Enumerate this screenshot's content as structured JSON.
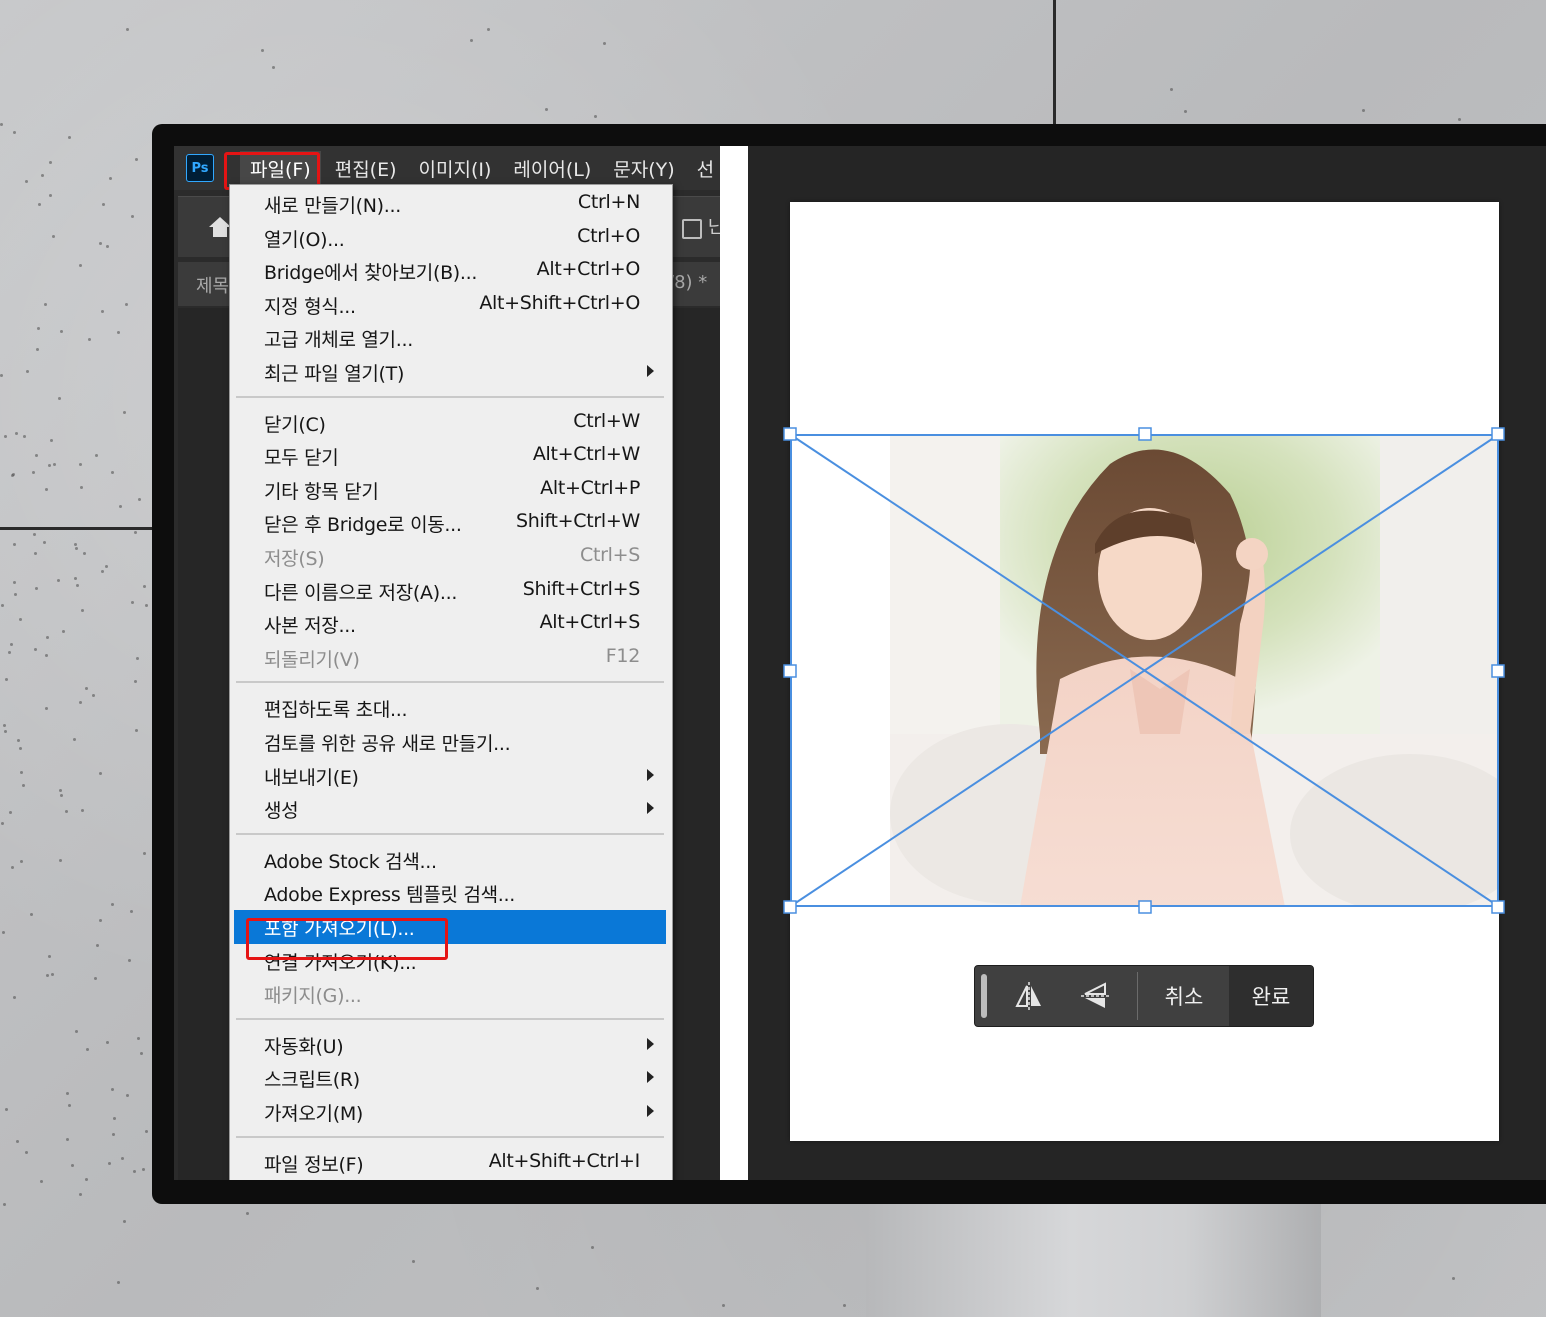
{
  "colors": {
    "highlight": "#0a78d7",
    "annotation_red": "#e51414",
    "transform_blue": "#4a8fe0",
    "menu_bg": "#efefef"
  },
  "app": {
    "logo": "Ps"
  },
  "menubar": {
    "items": [
      "파일(F)",
      "편집(E)",
      "이미지(I)",
      "레이어(L)",
      "문자(Y)",
      "선"
    ]
  },
  "options_bar": {
    "partial_text": "난"
  },
  "tabbar": {
    "title_partial": "제목",
    "zoom_partial": "/8) *"
  },
  "file_menu": {
    "groups": [
      [
        {
          "label": "새로 만들기(N)...",
          "shortcut": "Ctrl+N"
        },
        {
          "label": "열기(O)...",
          "shortcut": "Ctrl+O"
        },
        {
          "label": "Bridge에서 찾아보기(B)...",
          "shortcut": "Alt+Ctrl+O"
        },
        {
          "label": "지정 형식...",
          "shortcut": "Alt+Shift+Ctrl+O"
        },
        {
          "label": "고급 개체로 열기...",
          "shortcut": ""
        },
        {
          "label": "최근 파일 열기(T)",
          "shortcut": "",
          "submenu": true
        }
      ],
      [
        {
          "label": "닫기(C)",
          "shortcut": "Ctrl+W"
        },
        {
          "label": "모두 닫기",
          "shortcut": "Alt+Ctrl+W"
        },
        {
          "label": "기타 항목 닫기",
          "shortcut": "Alt+Ctrl+P"
        },
        {
          "label": "닫은 후 Bridge로 이동...",
          "shortcut": "Shift+Ctrl+W"
        },
        {
          "label": "저장(S)",
          "shortcut": "Ctrl+S",
          "disabled": true
        },
        {
          "label": "다른 이름으로 저장(A)...",
          "shortcut": "Shift+Ctrl+S"
        },
        {
          "label": "사본 저장...",
          "shortcut": "Alt+Ctrl+S"
        },
        {
          "label": "되돌리기(V)",
          "shortcut": "F12",
          "disabled": true
        }
      ],
      [
        {
          "label": "편집하도록 초대...",
          "shortcut": ""
        },
        {
          "label": "검토를 위한 공유 새로 만들기...",
          "shortcut": ""
        },
        {
          "label": "내보내기(E)",
          "shortcut": "",
          "submenu": true
        },
        {
          "label": "생성",
          "shortcut": "",
          "submenu": true
        }
      ],
      [
        {
          "label": "Adobe Stock 검색...",
          "shortcut": ""
        },
        {
          "label": "Adobe Express 템플릿 검색...",
          "shortcut": ""
        },
        {
          "label": "포함 가져오기(L)...",
          "shortcut": "",
          "highlighted": true
        },
        {
          "label": "연결 가져오기(K)...",
          "shortcut": ""
        },
        {
          "label": "패키지(G)...",
          "shortcut": "",
          "disabled": true
        }
      ],
      [
        {
          "label": "자동화(U)",
          "shortcut": "",
          "submenu": true
        },
        {
          "label": "스크립트(R)",
          "shortcut": "",
          "submenu": true
        },
        {
          "label": "가져오기(M)",
          "shortcut": "",
          "submenu": true
        }
      ],
      [
        {
          "label": "파일 정보(F)",
          "shortcut": "Alt+Shift+Ctrl+I"
        }
      ]
    ]
  },
  "transform_toolbar": {
    "flip_horizontal_icon": "flip-horizontal-icon",
    "flip_vertical_icon": "flip-vertical-icon",
    "cancel_label": "취소",
    "done_label": "완료"
  }
}
